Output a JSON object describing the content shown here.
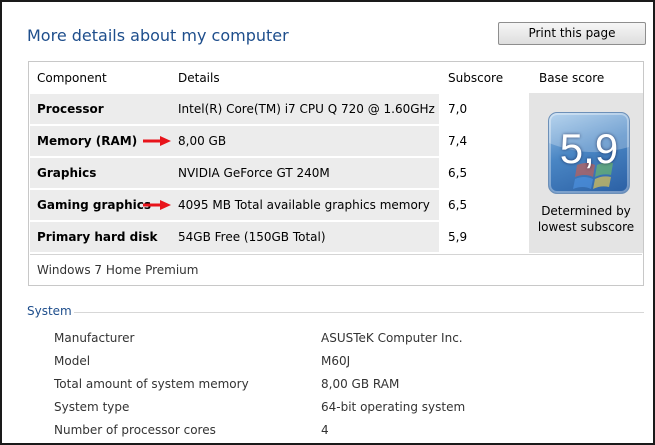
{
  "header": {
    "title": "More details about my computer",
    "print_label": "Print this page"
  },
  "score_table": {
    "columns": [
      "Component",
      "Details",
      "Subscore",
      "Base score"
    ],
    "rows": [
      {
        "component": "Processor",
        "details": "Intel(R) Core(TM) i7 CPU Q 720 @ 1.60GHz",
        "subscore": "7,0",
        "highlighted": false
      },
      {
        "component": "Memory (RAM)",
        "details": "8,00 GB",
        "subscore": "7,4",
        "highlighted": true
      },
      {
        "component": "Graphics",
        "details": "NVIDIA GeForce GT 240M",
        "subscore": "6,5",
        "highlighted": false
      },
      {
        "component": "Gaming graphics",
        "details": "4095 MB Total available graphics memory",
        "subscore": "6,5",
        "highlighted": true
      },
      {
        "component": "Primary hard disk",
        "details": "54GB Free (150GB Total)",
        "subscore": "5,9",
        "highlighted": false
      }
    ],
    "base_score": "5,9",
    "base_caption_line1": "Determined by",
    "base_caption_line2": "lowest subscore",
    "edition": "Windows 7 Home Premium"
  },
  "system": {
    "title": "System",
    "items": [
      {
        "label": "Manufacturer",
        "value": "ASUSTeK Computer Inc."
      },
      {
        "label": "Model",
        "value": "M60J"
      },
      {
        "label": "Total amount of system memory",
        "value": "8,00 GB RAM"
      },
      {
        "label": "System type",
        "value": "64-bit operating system"
      },
      {
        "label": "Number of processor cores",
        "value": "4"
      }
    ]
  },
  "colors": {
    "title_blue": "#1e4e8c",
    "row_gray": "#ececec",
    "arrow_red": "#e8141b",
    "badge_blue": "#2a5fa4"
  },
  "icons": [
    "red-arrow-icon",
    "windows-score-badge-icon"
  ]
}
